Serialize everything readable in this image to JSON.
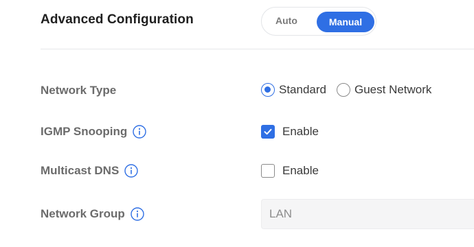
{
  "header": {
    "title": "Advanced Configuration",
    "mode_options": [
      "Auto",
      "Manual"
    ],
    "selected_mode": "Manual"
  },
  "colors": {
    "accent": "#2f6fe4",
    "label": "#6b6b6b",
    "divider": "#e6e7ea"
  },
  "settings": {
    "network_type": {
      "label": "Network Type",
      "options": [
        "Standard",
        "Guest Network"
      ],
      "selected": "Standard"
    },
    "igmp_snooping": {
      "label": "IGMP Snooping",
      "info_icon": "info-icon",
      "checkbox_label": "Enable",
      "checked": true
    },
    "multicast_dns": {
      "label": "Multicast DNS",
      "info_icon": "info-icon",
      "checkbox_label": "Enable",
      "checked": false
    },
    "network_group": {
      "label": "Network Group",
      "info_icon": "info-icon",
      "value": "LAN"
    }
  }
}
